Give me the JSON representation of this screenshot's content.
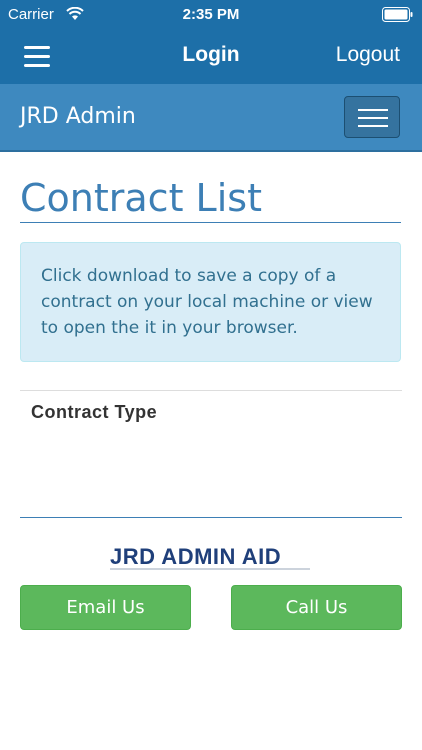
{
  "status_bar": {
    "carrier": "Carrier",
    "time": "2:35 PM"
  },
  "nav_bar": {
    "title": "Login",
    "logout_label": "Logout"
  },
  "site_header": {
    "brand": "JRD Admin"
  },
  "main": {
    "title": "Contract List",
    "info_text": "Click download to save a copy of a contract on your local machine or view to open the it in your browser.",
    "table_header": "Contract Type"
  },
  "footer": {
    "logo_text": "JRD ADMIN AID",
    "email_label": "Email Us",
    "call_label": "Call Us"
  },
  "colors": {
    "nav_blue": "#1d6fa8",
    "header_blue": "#3e89bf",
    "title_blue": "#3d7fb5",
    "info_bg": "#d9edf7",
    "info_text": "#31708f",
    "button_green": "#5cb85c"
  },
  "icons": [
    "wifi-icon",
    "battery-icon",
    "hamburger-menu-icon",
    "navbar-toggle-icon"
  ]
}
